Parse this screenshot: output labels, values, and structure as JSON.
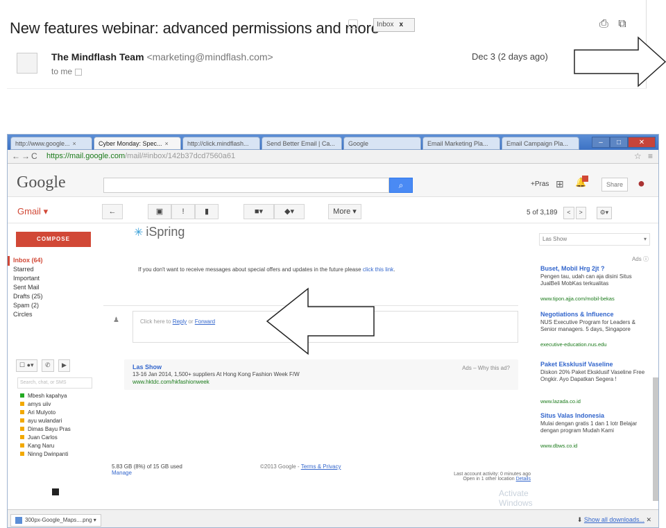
{
  "email": {
    "subject": "New features webinar: advanced permissions and more",
    "chip_label": "Inbox",
    "chip_close": "x",
    "sender_name": "The Mindflash Team",
    "sender_email": "<marketing@mindflash.com>",
    "recipient": "to me",
    "date": "Dec 3 (2 days ago)",
    "icons": [
      "print-icon",
      "new-window-icon"
    ]
  },
  "browser": {
    "tabs": [
      {
        "label": "http://www.google..."
      },
      {
        "label": "Cyber Monday: Spec..."
      },
      {
        "label": "http://click.mindflash..."
      },
      {
        "label": "Send Better Email | Ca..."
      },
      {
        "label": "Google"
      },
      {
        "label": "Email Marketing Pla..."
      },
      {
        "label": "Email Campaign Pla..."
      }
    ],
    "active_tab_index": 1,
    "url_host": "https://mail.google.com",
    "url_path": "/mail/#inbox/142b37dcd7560a61"
  },
  "google": {
    "logo": "Google",
    "plus": "+Pras",
    "share": "Share"
  },
  "gmail": {
    "label": "Gmail",
    "more_label": "More",
    "pager": "5 of 3,189",
    "compose": "COMPOSE",
    "nav": [
      {
        "label": "Inbox (64)",
        "active": true
      },
      {
        "label": "Starred"
      },
      {
        "label": "Important"
      },
      {
        "label": "Sent Mail"
      },
      {
        "label": "Drafts (25)"
      },
      {
        "label": "Spam (2)"
      },
      {
        "label": "Circles"
      }
    ],
    "chat_search_placeholder": "Search, chat, or SMS",
    "contacts": [
      {
        "name": "Mbesh kapahya",
        "status": "online"
      },
      {
        "name": "amys uiiv",
        "status": "idle"
      },
      {
        "name": "Ari Mulyoto",
        "status": "idle"
      },
      {
        "name": "ayu wulandari",
        "status": "idle"
      },
      {
        "name": "Dimas Bayu Pras",
        "status": "idle"
      },
      {
        "name": "Juan Carlos",
        "status": "idle"
      },
      {
        "name": "Kang Naru",
        "status": "idle"
      },
      {
        "name": "Ninng Dwinpanti",
        "status": "idle"
      }
    ]
  },
  "message": {
    "brand": "iSpring",
    "unsubscribe": "If you don't want to receive messages about special offers and updates in the future please",
    "unsubscribe_link": "click this link",
    "reply_prompt": "Click here to",
    "reply_link": "Reply",
    "reply_or": "or",
    "forward_link": "Forward",
    "ad": {
      "title": "Las Show",
      "desc": "13-16 Jan 2014, 1,500+ suppliers At Hong Kong Fashion Week F/W",
      "url": "www.hktdc.com/hkfashionweek",
      "label": "Ads – Why this ad?"
    },
    "storage": "5.83 GB (8%) of 15 GB used",
    "manage": "Manage",
    "copyright": "©2013 Google -",
    "terms": "Terms & Privacy",
    "activity": "Last account activity: 0 minutes ago",
    "activity2": "Open in 1 other location",
    "details": "Details",
    "watermark": "Activate Windows"
  },
  "ads": {
    "dropdown": "Las Show",
    "label": "Ads",
    "items": [
      {
        "title": "Buset, Mobil Hrg 2jt ?",
        "desc": "Pengen tau, udah can aja disini Situs JualBeli MobKas terkualitas",
        "url": "www.tipon.ajja.com/mobil-bekas"
      },
      {
        "title": "Negotiations & Influence",
        "desc": "NUS Executive Program for Leaders & Senior managers. 5 days, Singapore",
        "url": "executive-education.nus.edu"
      },
      {
        "title": "Paket Eksklusif Vaseline",
        "desc": "Diskon 20% Paket Eksklusif Vaseline Free Ongkir. Ayo Dapatkan Segera !",
        "url": "www.lazada.co.id"
      },
      {
        "title": "Situs Valas Indonesia",
        "desc": "Mulai dengan gratis 1 dan 1 lotr Belajar dengan program Mudah Kami",
        "url": "www.dbws.co.id"
      }
    ]
  },
  "download": {
    "file": "300px-Google_Maps....png",
    "show_all": "Show all downloads..."
  },
  "colors": {
    "gmail_red": "#d14836",
    "search_blue": "#4a8af4",
    "link_blue": "#3366cc",
    "url_green": "#1a7a1a"
  }
}
